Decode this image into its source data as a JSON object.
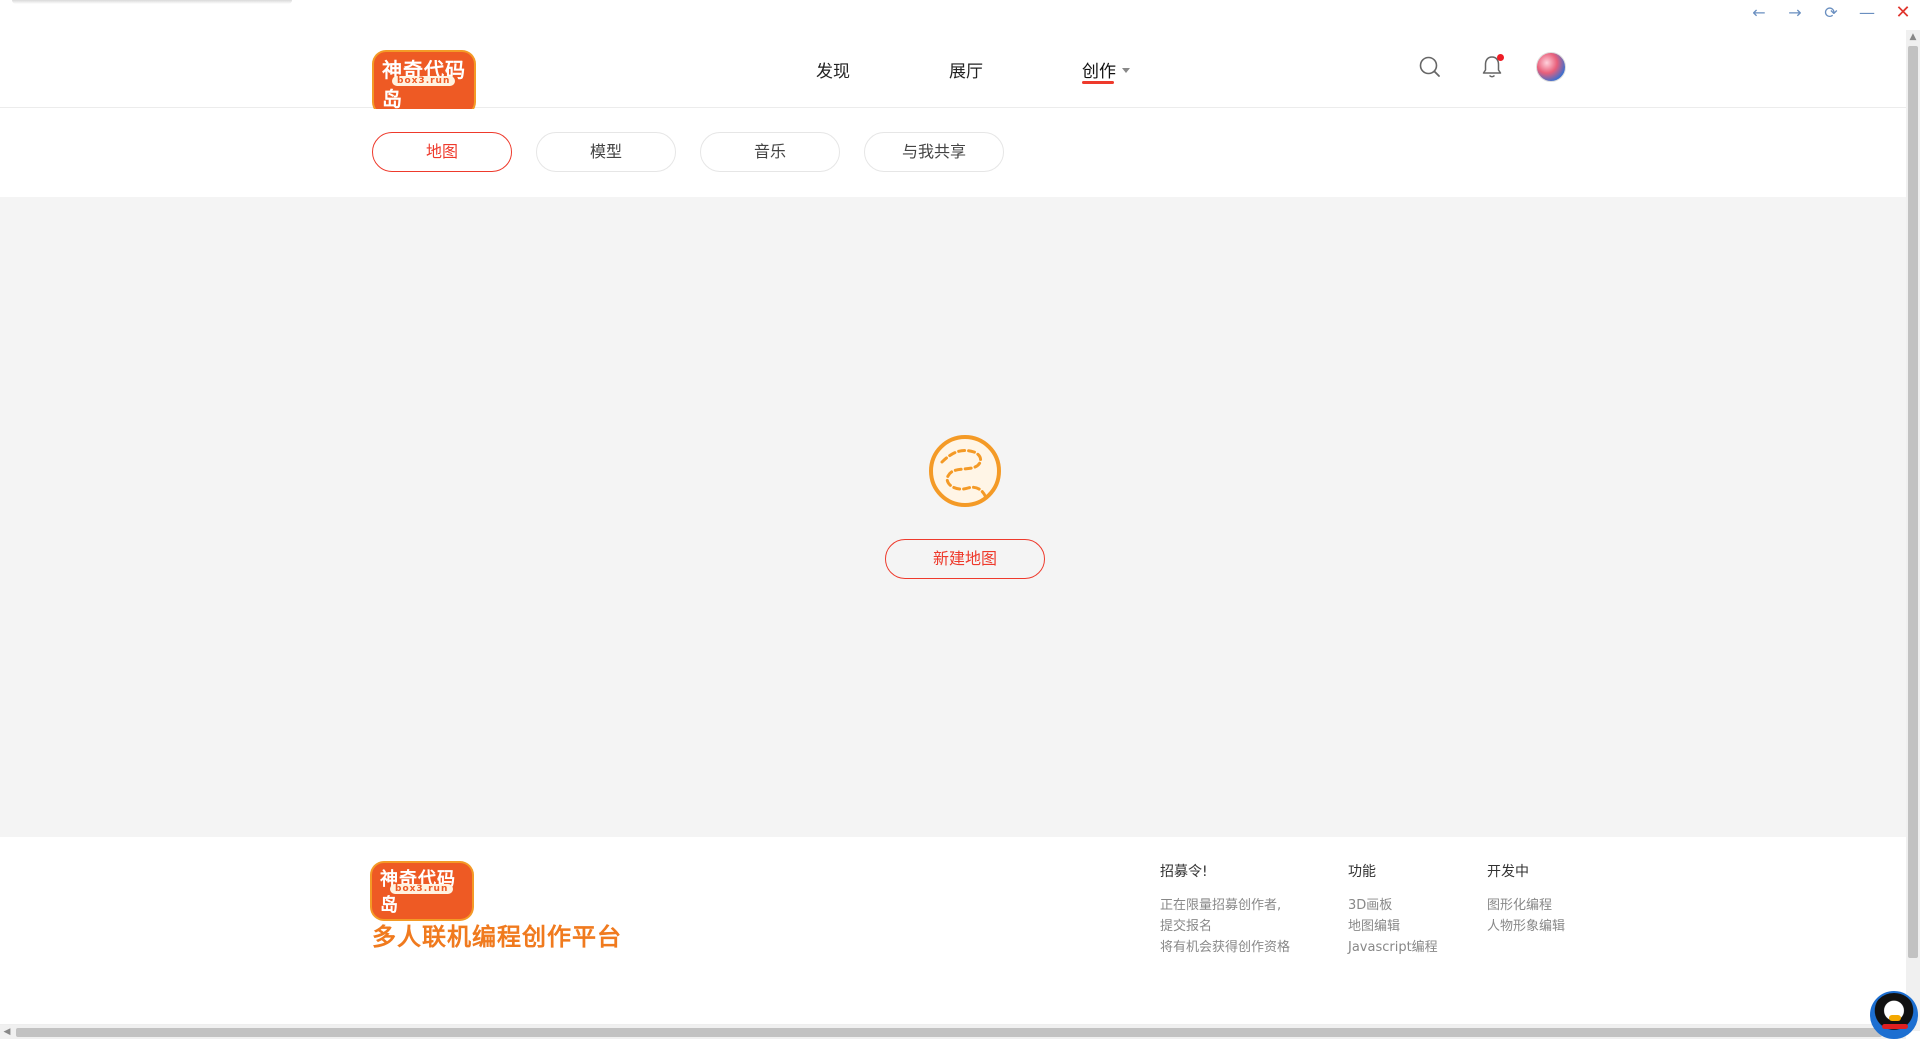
{
  "window": {
    "back": "←",
    "forward": "→",
    "reload": "⟳",
    "minimize": "—",
    "close": "✕"
  },
  "header": {
    "logo_text": "神奇代码岛",
    "logo_sub": "box3.run",
    "nav": [
      {
        "label": "发现"
      },
      {
        "label": "展厅"
      },
      {
        "label": "创作"
      }
    ]
  },
  "tabs": [
    {
      "label": "地图",
      "active": true
    },
    {
      "label": "模型"
    },
    {
      "label": "音乐"
    },
    {
      "label": "与我共享"
    }
  ],
  "main": {
    "new_button": "新建地图"
  },
  "footer": {
    "logo_text": "神奇代码岛",
    "logo_sub": "box3.run",
    "slogan": "多人联机编程创作平台",
    "columns": [
      {
        "head": "招募令!",
        "lines": [
          "正在限量招募创作者,",
          "提交报名",
          "将有机会获得创作资格"
        ]
      },
      {
        "head": "功能",
        "lines": [
          "3D画板",
          "地图编辑",
          "Javascript编程"
        ]
      },
      {
        "head": "开发中",
        "lines": [
          "图形化编程",
          "人物形象编辑"
        ]
      }
    ]
  },
  "colors": {
    "accent": "#ee3a2c",
    "brand_orange": "#f07a1e",
    "background": "#f4f4f4"
  }
}
